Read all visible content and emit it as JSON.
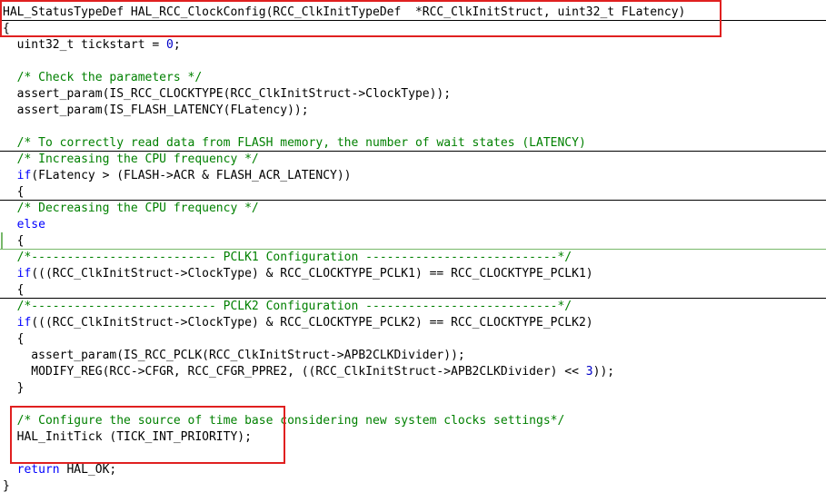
{
  "editor": {
    "colors": {
      "plain": "#000000",
      "comment": "#008000",
      "keyword": "#0000ff",
      "number": "#0000c8",
      "highlight_box": "#e02020",
      "fold_line": "#000000",
      "fold_line_green": "#77b86a"
    },
    "lines": [
      {
        "fold": "black",
        "tokens": [
          {
            "t": "HAL_StatusTypeDef HAL_RCC_ClockConfig(RCC_ClkInitTypeDef  *RCC_ClkInitStruct, uint32_t FLatency)",
            "c": "plain"
          }
        ]
      },
      {
        "tokens": [
          {
            "t": "{",
            "c": "plain"
          }
        ]
      },
      {
        "tokens": [
          {
            "t": "  uint32_t tickstart = ",
            "c": "plain"
          },
          {
            "t": "0",
            "c": "number"
          },
          {
            "t": ";",
            "c": "plain"
          }
        ]
      },
      {
        "tokens": []
      },
      {
        "tokens": [
          {
            "t": "  /* Check the parameters */",
            "c": "comment"
          }
        ]
      },
      {
        "tokens": [
          {
            "t": "  assert_param(IS_RCC_CLOCKTYPE(RCC_ClkInitStruct->ClockType));",
            "c": "plain"
          }
        ]
      },
      {
        "tokens": [
          {
            "t": "  assert_param(IS_FLASH_LATENCY(FLatency));",
            "c": "plain"
          }
        ]
      },
      {
        "tokens": []
      },
      {
        "fold": "black",
        "tokens": [
          {
            "t": "  /* To correctly read data from FLASH memory, the number of wait states (LATENCY)",
            "c": "comment"
          }
        ]
      },
      {
        "tokens": [
          {
            "t": "  /* Increasing the CPU frequency */",
            "c": "comment"
          }
        ]
      },
      {
        "tokens": [
          {
            "t": "  ",
            "c": "plain"
          },
          {
            "t": "if",
            "c": "keyword"
          },
          {
            "t": "(FLatency > (FLASH->ACR & FLASH_ACR_LATENCY))",
            "c": "plain"
          }
        ]
      },
      {
        "fold": "black",
        "tokens": [
          {
            "t": "  {",
            "c": "plain"
          }
        ]
      },
      {
        "tokens": [
          {
            "t": "  /* Decreasing the CPU frequency */",
            "c": "comment"
          }
        ]
      },
      {
        "tokens": [
          {
            "t": "  ",
            "c": "plain"
          },
          {
            "t": "else",
            "c": "keyword"
          }
        ]
      },
      {
        "fold": "green",
        "tokens": [
          {
            "t": "  {",
            "c": "plain"
          }
        ]
      },
      {
        "tokens": [
          {
            "t": "  /*-------------------------- PCLK1 Configuration ---------------------------*/",
            "c": "comment"
          }
        ]
      },
      {
        "tokens": [
          {
            "t": "  ",
            "c": "plain"
          },
          {
            "t": "if",
            "c": "keyword"
          },
          {
            "t": "(((RCC_ClkInitStruct->ClockType) & RCC_CLOCKTYPE_PCLK1) == RCC_CLOCKTYPE_PCLK1)",
            "c": "plain"
          }
        ]
      },
      {
        "fold": "black",
        "tokens": [
          {
            "t": "  {",
            "c": "plain"
          }
        ]
      },
      {
        "tokens": [
          {
            "t": "  /*-------------------------- PCLK2 Configuration ---------------------------*/",
            "c": "comment"
          }
        ]
      },
      {
        "tokens": [
          {
            "t": "  ",
            "c": "plain"
          },
          {
            "t": "if",
            "c": "keyword"
          },
          {
            "t": "(((RCC_ClkInitStruct->ClockType) & RCC_CLOCKTYPE_PCLK2) == RCC_CLOCKTYPE_PCLK2)",
            "c": "plain"
          }
        ]
      },
      {
        "tokens": [
          {
            "t": "  {",
            "c": "plain"
          }
        ]
      },
      {
        "tokens": [
          {
            "t": "    assert_param(IS_RCC_PCLK(RCC_ClkInitStruct->APB2CLKDivider));",
            "c": "plain"
          }
        ]
      },
      {
        "tokens": [
          {
            "t": "    MODIFY_REG(RCC->CFGR, RCC_CFGR_PPRE2, ((RCC_ClkInitStruct->APB2CLKDivider) << ",
            "c": "plain"
          },
          {
            "t": "3",
            "c": "number"
          },
          {
            "t": "));",
            "c": "plain"
          }
        ]
      },
      {
        "tokens": [
          {
            "t": "  }",
            "c": "plain"
          }
        ]
      },
      {
        "tokens": []
      },
      {
        "tokens": [
          {
            "t": "  /* Configure the source of time base considering new system clocks settings*/",
            "c": "comment"
          }
        ]
      },
      {
        "tokens": [
          {
            "t": "  HAL_InitTick (TICK_INT_PRIORITY);",
            "c": "plain"
          }
        ]
      },
      {
        "tokens": []
      },
      {
        "tokens": [
          {
            "t": "  ",
            "c": "plain"
          },
          {
            "t": "return",
            "c": "keyword"
          },
          {
            "t": " HAL_OK;",
            "c": "plain"
          }
        ]
      },
      {
        "tokens": [
          {
            "t": "}",
            "c": "plain"
          }
        ]
      }
    ]
  }
}
